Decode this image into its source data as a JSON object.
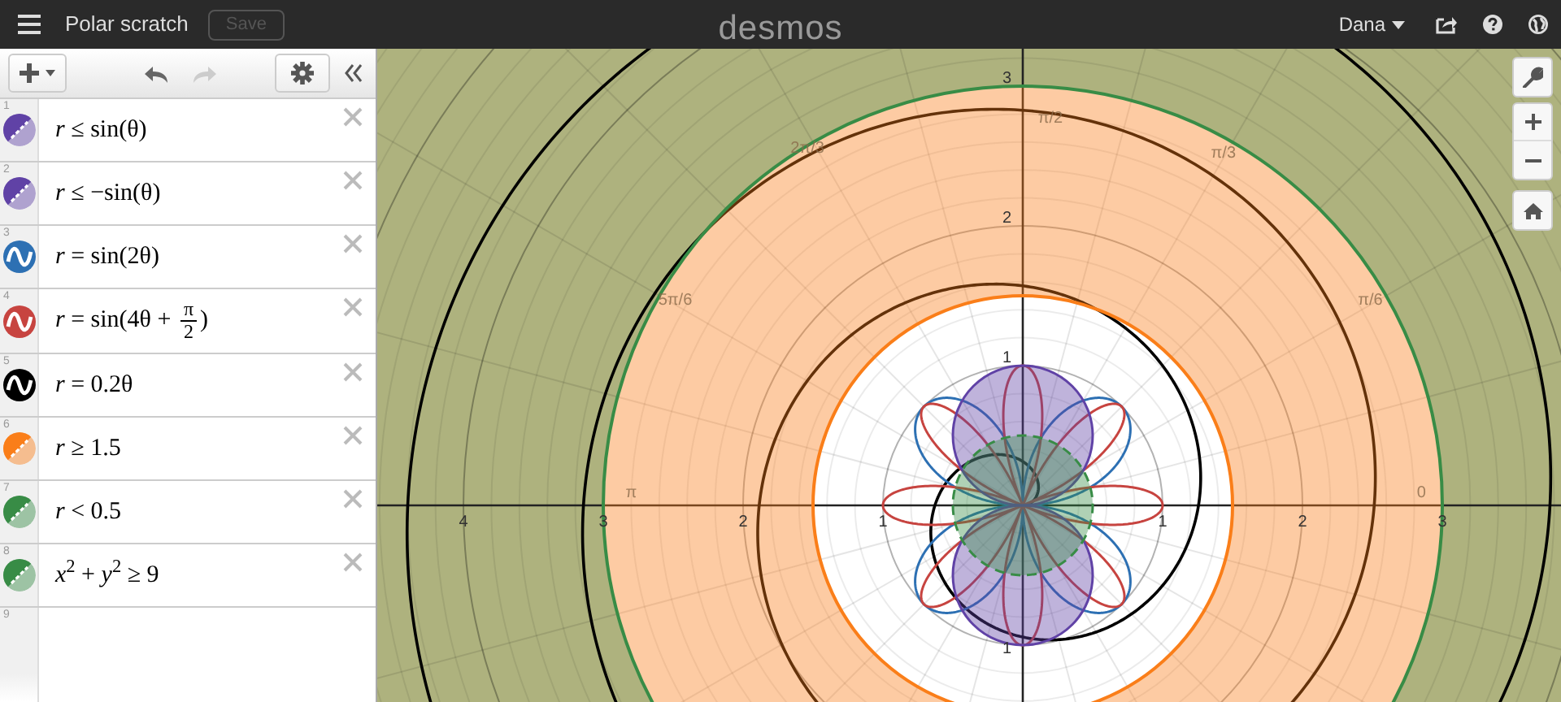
{
  "top_bar": {
    "graph_title": "Polar scratch",
    "save_button": {
      "label": "Save",
      "disabled": true
    },
    "logo": "desmos",
    "user": "Dana"
  },
  "toolbar": {
    "undo": {
      "disabled": false
    },
    "redo": {
      "disabled": true
    }
  },
  "expressions": [
    {
      "number": "1",
      "kind": "fill",
      "color": "#6042a6",
      "math": "*r* ≤ sin(θ)"
    },
    {
      "number": "2",
      "kind": "fill",
      "color": "#6042a6",
      "math": "*r* ≤ −sin(θ)"
    },
    {
      "number": "3",
      "kind": "curve",
      "color": "#2d70b3",
      "math": "*r* = sin(2θ)"
    },
    {
      "number": "4",
      "kind": "curve",
      "color": "#c74440",
      "math": "*r* = sin(4θ + ",
      "fraction": {
        "numerator": "π",
        "denominator": "2"
      },
      "math_after": ")"
    },
    {
      "number": "5",
      "kind": "curve",
      "color": "#000000",
      "math": "*r* = 0.2θ"
    },
    {
      "number": "6",
      "kind": "fill",
      "color": "#fa7e19",
      "math": "*r* ≥ 1.5"
    },
    {
      "number": "7",
      "kind": "fill",
      "color": "#388c46",
      "math": "*r* < 0.5"
    },
    {
      "number": "8",
      "kind": "fill",
      "color": "#388c46",
      "math": "*x*$^{2}$ + *y*$^{2}$ ≥ 9"
    },
    {
      "number": "9",
      "kind": "empty"
    }
  ],
  "graph": {
    "x_tick_labels": [
      "4",
      "3",
      "2",
      "1",
      "1",
      "2",
      "3"
    ],
    "y_tick_labels": [
      "3",
      "2",
      "1",
      "1"
    ],
    "angle_labels": [
      "π/2",
      "2π/3",
      "π/3",
      "5π/6",
      "π/6",
      "π",
      "0"
    ]
  }
}
